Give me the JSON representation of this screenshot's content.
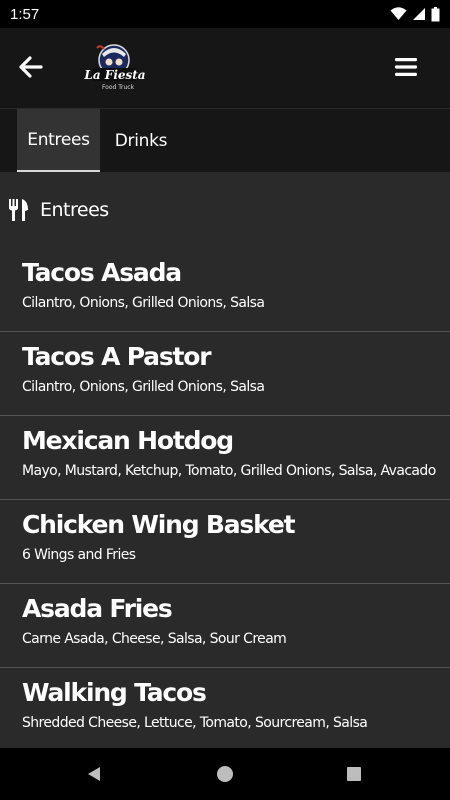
{
  "status_bar": {
    "time": "1:57",
    "icons": [
      "wifi-icon",
      "signal-icon",
      "battery-icon"
    ]
  },
  "app_bar": {
    "back_icon": "arrow-left-icon",
    "logo_text": "La Fiesta",
    "logo_subtext": "Food Truck",
    "menu_icon": "hamburger-icon"
  },
  "tabs": [
    {
      "label": "Entrees",
      "active": true
    },
    {
      "label": "Drinks",
      "active": false
    }
  ],
  "section": {
    "icon": "fork-knife-icon",
    "title": "Entrees"
  },
  "items": [
    {
      "name": "Tacos Asada",
      "description": "Cilantro, Onions, Grilled Onions, Salsa"
    },
    {
      "name": "Tacos A Pastor",
      "description": "Cilantro, Onions, Grilled Onions, Salsa"
    },
    {
      "name": "Mexican Hotdog",
      "description": "Mayo, Mustard, Ketchup, Tomato, Grilled Onions, Salsa, Avacado"
    },
    {
      "name": "Chicken Wing Basket",
      "description": "6 Wings and Fries"
    },
    {
      "name": "Asada Fries",
      "description": "Carne Asada, Cheese, Salsa, Sour Cream"
    },
    {
      "name": "Walking Tacos",
      "description": "Shredded Cheese, Lettuce, Tomato, Sourcream, Salsa"
    }
  ],
  "colors": {
    "background": "#2a2a2a",
    "appbar": "#161616",
    "active_tab": "#333333",
    "divider": "#555555"
  }
}
